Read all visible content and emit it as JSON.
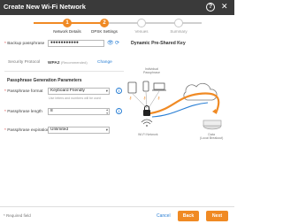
{
  "window": {
    "title": "Create New Wi-Fi Network",
    "help_label": "?",
    "close_label": "✕"
  },
  "steps": [
    {
      "number": "1",
      "label": "Network Details",
      "state": "done"
    },
    {
      "number": "2",
      "label": "DPSK Settings",
      "state": "current"
    },
    {
      "number": "3",
      "label": "Venues",
      "state": "todo"
    },
    {
      "number": "4",
      "label": "Summary",
      "state": "todo"
    }
  ],
  "form": {
    "backup_passphrase": {
      "label": "Backup passphrase",
      "value": "●●●●●●●●●●●",
      "icons": [
        "eye-icon",
        "refresh-icon"
      ]
    },
    "security_protocol": {
      "label": "Security Protocol",
      "value": "WPA2",
      "note": "(Recommended)",
      "change_link": "Change"
    },
    "section_title": "Passphrase Generation Parameters",
    "passphrase_format": {
      "label": "Passphrase format",
      "value": "Keyboard Friendly",
      "hint": "Use letters and numbers will be used"
    },
    "passphrase_length": {
      "label": "Passphrase length",
      "value": "8"
    },
    "passphrase_expiration": {
      "label": "Passphrase expiration",
      "value": "Unlimited"
    }
  },
  "diagram": {
    "title": "Dynamic Pre-Shared Key",
    "labels": {
      "individual": "Individual\nPassphrase",
      "network": "Wi-Fi Network",
      "gateway": "Data\n(Local Breakout)"
    }
  },
  "footer": {
    "required_note": "* Required field",
    "cancel": "Cancel",
    "back": "Back",
    "next": "Next"
  },
  "colors": {
    "accent": "#f08a24",
    "link": "#2a7fd4",
    "titlebar": "#3a3a3a"
  }
}
